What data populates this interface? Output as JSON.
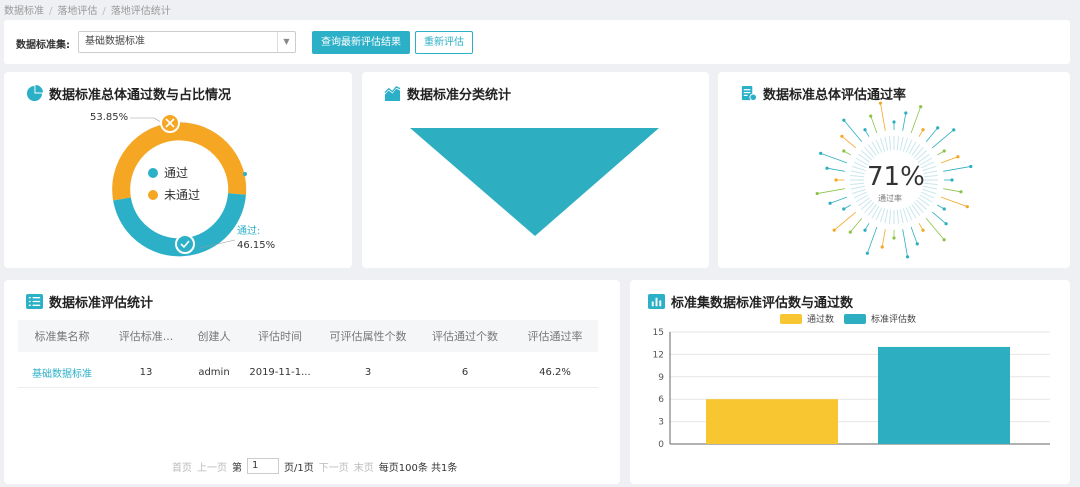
{
  "breadcrumb": [
    "数据标准",
    "落地评估",
    "落地评估统计"
  ],
  "filter": {
    "label": "数据标准集:",
    "select_value": "基础数据标准",
    "query_button": "查询最新评估结果",
    "reeval_button": "重新评估"
  },
  "colors": {
    "accent": "#2cb0c7",
    "orange": "#f5a623",
    "yellow": "#f8c630",
    "teal": "#2eaec1"
  },
  "card_pass_ratio": {
    "title": "数据标准总体通过数与占比情况",
    "legend": [
      "通过",
      "未通过"
    ],
    "fail_pct": "53.85%",
    "pass_label": "通过:",
    "pass_pct": "46.15%",
    "chart_data": {
      "type": "pie",
      "slices": [
        {
          "name": "通过",
          "value": 46.15
        },
        {
          "name": "未通过",
          "value": 53.85
        }
      ]
    }
  },
  "card_category": {
    "title": "数据标准分类统计"
  },
  "card_rate": {
    "title": "数据标准总体评估通过率",
    "value": "71%",
    "sub": "通过率"
  },
  "card_table": {
    "title": "数据标准评估统计",
    "columns": [
      "标准集名称",
      "评估标准...",
      "创建人",
      "评估时间",
      "可评估属性个数",
      "评估通过个数",
      "评估通过率"
    ],
    "rows": [
      [
        "基础数据标准",
        "13",
        "admin",
        "2019-11-1...",
        "3",
        "6",
        "46.2%"
      ]
    ],
    "pager": {
      "first": "首页",
      "prev": "上一页",
      "page_prefix": "第",
      "page": "1",
      "page_suffix": "页/1页",
      "next": "下一页",
      "last": "末页",
      "summary": "每页100条 共1条"
    }
  },
  "card_bar": {
    "title": "标准集数据标准评估数与通过数",
    "legend": [
      "通过数",
      "标准评估数"
    ],
    "chart_data": {
      "type": "bar",
      "categories": [
        ""
      ],
      "series": [
        {
          "name": "通过数",
          "values": [
            6
          ]
        },
        {
          "name": "标准评估数",
          "values": [
            13
          ]
        }
      ],
      "yticks": [
        "0",
        "3",
        "6",
        "9",
        "12",
        "15"
      ],
      "ylim": [
        0,
        15
      ],
      "grid": true
    }
  }
}
